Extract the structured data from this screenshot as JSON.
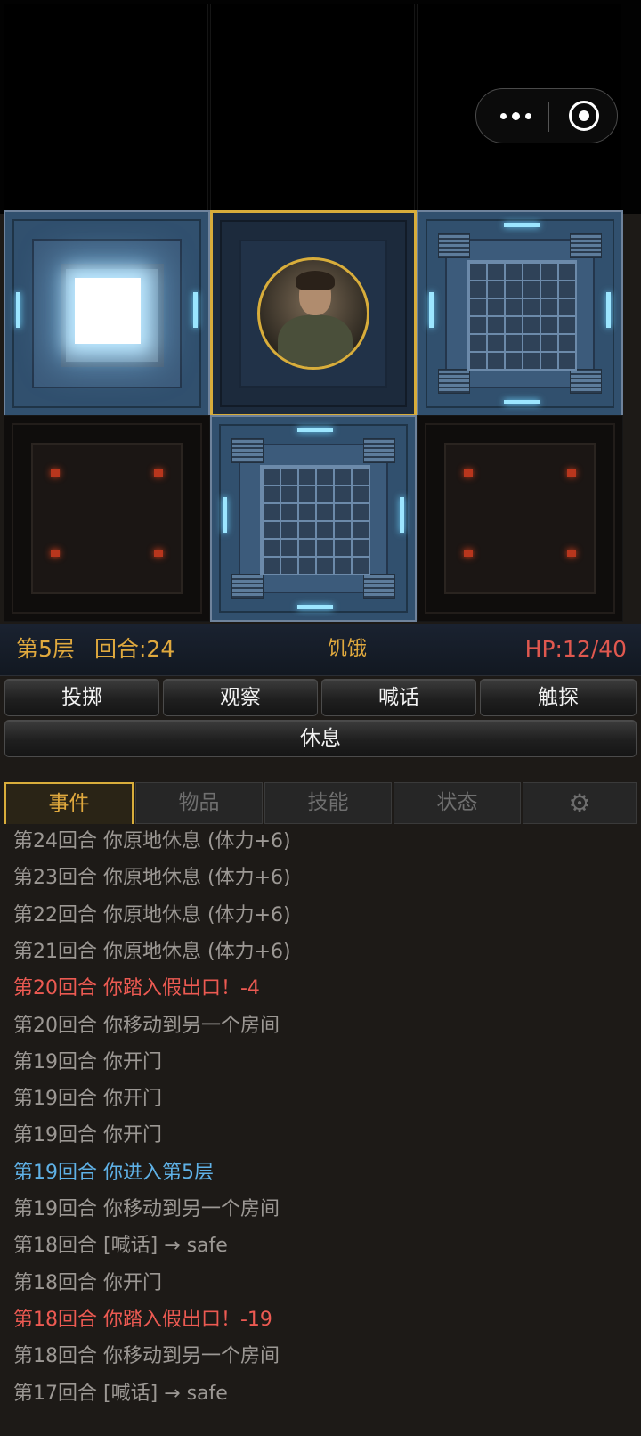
{
  "status": {
    "floor": "第5层",
    "turn": "回合:24",
    "hunger": "饥饿",
    "hp": "HP:12/40"
  },
  "rooms": [
    {
      "type": "exit-portal",
      "state": "lit"
    },
    {
      "type": "current",
      "state": "lit",
      "occupant": "player-avatar"
    },
    {
      "type": "grate",
      "state": "lit"
    },
    {
      "type": "unexplored",
      "state": "dark"
    },
    {
      "type": "grate",
      "state": "lit"
    },
    {
      "type": "unexplored",
      "state": "dark"
    }
  ],
  "actions": {
    "throw": "投掷",
    "observe": "观察",
    "shout": "喊话",
    "probe": "触探",
    "rest": "休息"
  },
  "tabs": {
    "events": "事件",
    "items": "物品",
    "skills": "技能",
    "status": "状态",
    "settings_icon": "gear-icon"
  },
  "log": [
    {
      "text": "第24回合 你原地休息 (体力+6)",
      "kind": "normal"
    },
    {
      "text": "第23回合 你原地休息 (体力+6)",
      "kind": "normal"
    },
    {
      "text": "第22回合 你原地休息 (体力+6)",
      "kind": "normal"
    },
    {
      "text": "第21回合 你原地休息 (体力+6)",
      "kind": "normal"
    },
    {
      "text": "第20回合 你踏入假出口！-4",
      "kind": "danger"
    },
    {
      "text": "第20回合 你移动到另一个房间",
      "kind": "normal"
    },
    {
      "text": "第19回合 你开门",
      "kind": "normal"
    },
    {
      "text": "第19回合 你开门",
      "kind": "normal"
    },
    {
      "text": "第19回合 你开门",
      "kind": "normal"
    },
    {
      "text": "第19回合 你进入第5层",
      "kind": "info"
    },
    {
      "text": "第19回合 你移动到另一个房间",
      "kind": "normal"
    },
    {
      "text": "第18回合 [喊话] → safe",
      "kind": "normal"
    },
    {
      "text": "第18回合 你开门",
      "kind": "normal"
    },
    {
      "text": "第18回合 你踏入假出口！-19",
      "kind": "danger"
    },
    {
      "text": "第18回合 你移动到另一个房间",
      "kind": "normal"
    },
    {
      "text": "第17回合 [喊话] → safe",
      "kind": "normal"
    }
  ],
  "colors": {
    "normal": "#9c9894",
    "danger": "#ec5a52",
    "info": "#5fb1e6",
    "accent": "#d8ad3b"
  }
}
